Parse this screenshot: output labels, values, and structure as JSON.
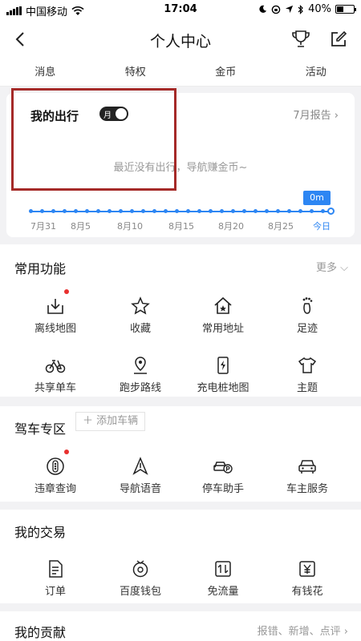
{
  "status_bar": {
    "carrier": "中国移动",
    "time": "17:04",
    "battery": "40%",
    "battery_level": 0.4
  },
  "header": {
    "title": "个人中心"
  },
  "tabs": [
    "消息",
    "特权",
    "金币",
    "活动"
  ],
  "trip": {
    "title": "我的出行",
    "toggle_label": "月",
    "report": "7月报告",
    "empty_message": "最近没有出行，导航赚金币~",
    "distance": "0m",
    "timeline_labels": [
      "7月31",
      "8月5",
      "8月10",
      "8月15",
      "8月20",
      "8月25",
      "今日"
    ]
  },
  "common": {
    "title": "常用功能",
    "more": "更多",
    "items": [
      {
        "label": "离线地图",
        "icon": "download-icon"
      },
      {
        "label": "收藏",
        "icon": "star-icon"
      },
      {
        "label": "常用地址",
        "icon": "home-star-icon"
      },
      {
        "label": "足迹",
        "icon": "footprint-icon"
      },
      {
        "label": "共享单车",
        "icon": "bicycle-icon"
      },
      {
        "label": "跑步路线",
        "icon": "location-pin-icon"
      },
      {
        "label": "充电桩地图",
        "icon": "charging-icon"
      },
      {
        "label": "主题",
        "icon": "tshirt-icon"
      }
    ]
  },
  "driving": {
    "title": "驾车专区",
    "add_car": "添加车辆",
    "items": [
      {
        "label": "违章查询",
        "icon": "traffic-light-icon"
      },
      {
        "label": "导航语音",
        "icon": "voice-nav-icon"
      },
      {
        "label": "停车助手",
        "icon": "parking-icon"
      },
      {
        "label": "车主服务",
        "icon": "car-icon"
      }
    ]
  },
  "deals": {
    "title": "我的交易",
    "items": [
      {
        "label": "订单",
        "icon": "order-icon"
      },
      {
        "label": "百度钱包",
        "icon": "wallet-icon"
      },
      {
        "label": "免流量",
        "icon": "data-icon"
      },
      {
        "label": "有钱花",
        "icon": "money-icon"
      }
    ]
  },
  "contribution": {
    "title": "我的贡献",
    "more": "报错、新增、点评"
  }
}
